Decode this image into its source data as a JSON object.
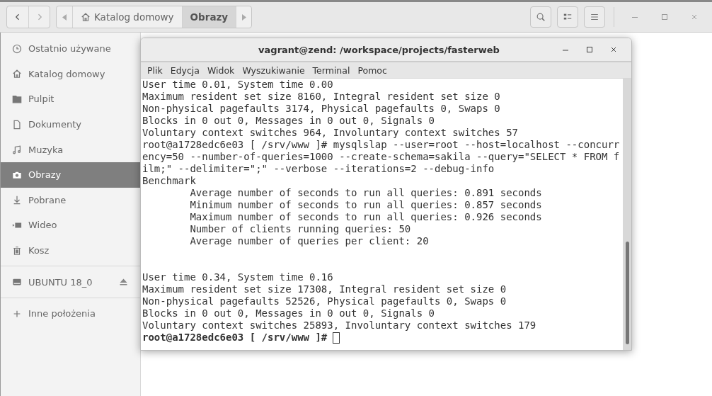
{
  "header": {
    "nav": [
      {
        "kind": "back",
        "disabled": false
      },
      {
        "kind": "forward",
        "disabled": true
      }
    ],
    "path": [
      {
        "label": "Katalog domowy",
        "kind": "home",
        "selected": false
      },
      {
        "label": "Obrazy",
        "kind": "folder",
        "selected": true
      }
    ],
    "tools": [
      {
        "kind": "search"
      },
      {
        "kind": "view"
      },
      {
        "kind": "menu"
      }
    ]
  },
  "sidebar": {
    "items": [
      {
        "label": "Ostatnio używane",
        "kind": "recent",
        "selected": false
      },
      {
        "label": "Katalog domowy",
        "kind": "home",
        "selected": false
      },
      {
        "label": "Pulpit",
        "kind": "desktop",
        "selected": false
      },
      {
        "label": "Dokumenty",
        "kind": "documents",
        "selected": false
      },
      {
        "label": "Muzyka",
        "kind": "music",
        "selected": false
      },
      {
        "label": "Obrazy",
        "kind": "pictures",
        "selected": true
      },
      {
        "label": "Pobrane",
        "kind": "downloads",
        "selected": false
      },
      {
        "label": "Wideo",
        "kind": "video",
        "selected": false
      },
      {
        "label": "Kosz",
        "kind": "trash",
        "selected": false
      }
    ],
    "devices": [
      {
        "label": "UBUNTU 18_0",
        "kind": "drive",
        "selected": false
      }
    ],
    "other": [
      {
        "label": "Inne położenia",
        "kind": "other",
        "selected": false
      }
    ]
  },
  "terminal": {
    "title": "vagrant@zend: /workspace/projects/fasterweb",
    "menu": [
      "Plik",
      "Edycja",
      "Widok",
      "Wyszukiwanie",
      "Terminal",
      "Pomoc"
    ],
    "lines": [
      {
        "kind": "output",
        "text": "User time 0.01, System time 0.00"
      },
      {
        "kind": "output",
        "text": "Maximum resident set size 8160, Integral resident set size 0"
      },
      {
        "kind": "output",
        "text": "Non-physical pagefaults 3174, Physical pagefaults 0, Swaps 0"
      },
      {
        "kind": "output",
        "text": "Blocks in 0 out 0, Messages in 0 out 0, Signals 0"
      },
      {
        "kind": "output",
        "text": "Voluntary context switches 964, Involuntary context switches 57"
      },
      {
        "kind": "output",
        "text": "root@a1728edc6e03 [ /srv/www ]# mysqlslap --user=root --host=localhost --concurr"
      },
      {
        "kind": "output",
        "text": "ency=50 --number-of-queries=1000 --create-schema=sakila --query=\"SELECT * FROM f"
      },
      {
        "kind": "output",
        "text": "ilm;\" --delimiter=\";\" --verbose --iterations=2 --debug-info"
      },
      {
        "kind": "output",
        "text": "Benchmark"
      },
      {
        "kind": "output",
        "text": "        Average number of seconds to run all queries: 0.891 seconds"
      },
      {
        "kind": "output",
        "text": "        Minimum number of seconds to run all queries: 0.857 seconds"
      },
      {
        "kind": "output",
        "text": "        Maximum number of seconds to run all queries: 0.926 seconds"
      },
      {
        "kind": "output",
        "text": "        Number of clients running queries: 50"
      },
      {
        "kind": "output",
        "text": "        Average number of queries per client: 20"
      },
      {
        "kind": "blank"
      },
      {
        "kind": "blank"
      },
      {
        "kind": "output",
        "text": "User time 0.34, System time 0.16"
      },
      {
        "kind": "output",
        "text": "Maximum resident set size 17308, Integral resident set size 0"
      },
      {
        "kind": "output",
        "text": "Non-physical pagefaults 52526, Physical pagefaults 0, Swaps 0"
      },
      {
        "kind": "output",
        "text": "Blocks in 0 out 0, Messages in 0 out 0, Signals 0"
      },
      {
        "kind": "output",
        "text": "Voluntary context switches 25893, Involuntary context switches 179"
      },
      {
        "kind": "prompt",
        "text": "root@a1728edc6e03 [ /srv/www ]#"
      }
    ]
  }
}
